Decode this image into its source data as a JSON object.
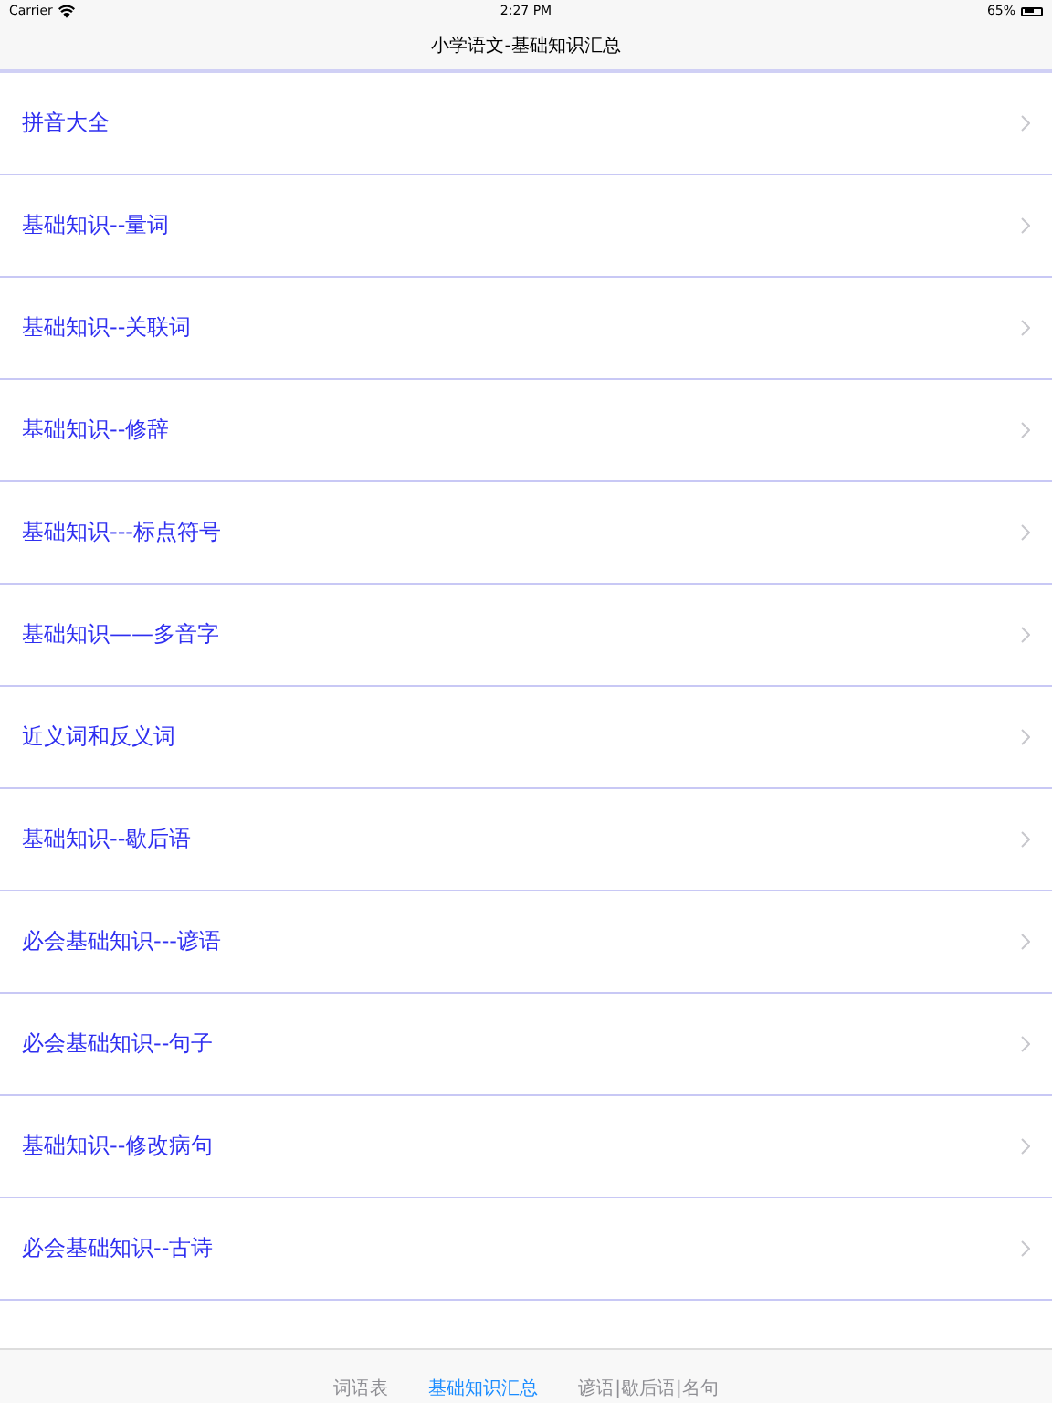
{
  "status_bar": {
    "carrier": "Carrier",
    "time": "2:27 PM",
    "battery": "65%"
  },
  "nav_bar": {
    "title": "小学语文-基础知识汇总"
  },
  "list": {
    "items": [
      {
        "label": "拼音大全"
      },
      {
        "label": "基础知识--量词"
      },
      {
        "label": "基础知识--关联词"
      },
      {
        "label": "基础知识--修辞"
      },
      {
        "label": "基础知识---标点符号"
      },
      {
        "label": "基础知识——多音字"
      },
      {
        "label": "近义词和反义词"
      },
      {
        "label": "基础知识--歇后语"
      },
      {
        "label": "必会基础知识---谚语"
      },
      {
        "label": "必会基础知识--句子"
      },
      {
        "label": "基础知识--修改病句"
      },
      {
        "label": "必会基础知识--古诗"
      }
    ]
  },
  "tab_bar": {
    "tabs": [
      {
        "label": "词语表",
        "selected": false
      },
      {
        "label": "基础知识汇总",
        "selected": true
      },
      {
        "label": "谚语|歇后语|名句",
        "selected": false
      }
    ]
  }
}
